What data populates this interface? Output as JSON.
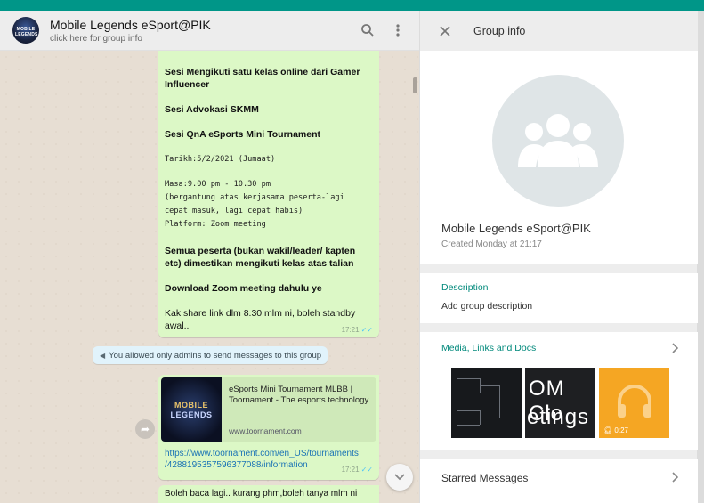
{
  "colors": {
    "accent": "#00897b",
    "bubble": "#dcf8c6",
    "topbar": "#009688"
  },
  "chat": {
    "title": "Mobile Legends eSport@PIK",
    "subtitle": "click here for group info",
    "avatar_text": "MOBILE LEGENDS",
    "icons": [
      "search-icon",
      "menu-dots-icon"
    ]
  },
  "messages": {
    "m1": {
      "lines": [
        "Sesi Mengikuti satu kelas online dari Gamer",
        "Influencer",
        "Sesi Advokasi SKMM",
        "Sesi QnA eSports Mini Tournament",
        "Tarikh:5/2/2021 (Jumaat)",
        "Masa:9.00 pm - 10.30 pm",
        "(bergantung atas kerjasama peserta-lagi",
        "cepat masuk, lagi cepat habis)",
        "Platform: Zoom meeting",
        "Semua peserta (bukan wakil/leader/ kapten",
        "etc) dimestikan mengikuti kelas atas talian",
        "Download Zoom meeting dahulu ye",
        "Kak share link dlm 8.30 mlm ni, boleh standby",
        "awal.."
      ],
      "time": "17:21"
    },
    "system": "You allowed only admins to send messages to this group",
    "m2": {
      "thumb_line1": "MOBILE",
      "thumb_line2": "LEGENDS",
      "link_title": "eSports Mini Tournament MLBB | Toornament - The esports technology",
      "link_domain": "www.toornament.com",
      "url_line1": "https://www.toornament.com/en_US/tournaments",
      "url_line2": "/4288195357596377088/information",
      "time": "17:21"
    },
    "m3": {
      "text": "Boleh baca lagi.. kurang phm,boleh tanya mlm ni"
    }
  },
  "info": {
    "title": "Group info",
    "group_name": "Mobile Legends eSport@PIK",
    "created": "Created Monday at 21:17",
    "description_label": "Description",
    "description_add": "Add group description",
    "media_label": "Media, Links and Docs",
    "media_thumb2_line1": "OM Clo",
    "media_thumb2_line2": "etings",
    "media_audio_duration": "0:27",
    "starred_label": "Starred Messages"
  }
}
